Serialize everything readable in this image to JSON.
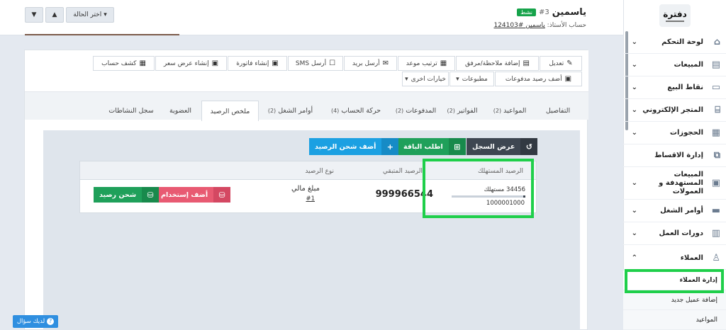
{
  "brand": {
    "logo_text": "دفترة"
  },
  "sidebar": {
    "items": [
      {
        "label": "لوحة التحكم",
        "icon": "home-icon"
      },
      {
        "label": "المبيعات",
        "icon": "invoice-icon"
      },
      {
        "label": "نقاط البيع",
        "icon": "monitor-icon"
      },
      {
        "label": "المتجر الإلكتروني",
        "icon": "store-icon"
      },
      {
        "label": "الحجوزات",
        "icon": "calendar-icon"
      },
      {
        "label": "إدارة الاقساط",
        "icon": "installments-icon"
      },
      {
        "label": "المبيعات المستهدفة و العمولات",
        "icon": "money-icon"
      },
      {
        "label": "أوامر الشغل",
        "icon": "briefcase-icon"
      },
      {
        "label": "دورات العمل",
        "icon": "cycle-icon"
      },
      {
        "label": "العملاء",
        "icon": "users-icon"
      }
    ],
    "sub_items": [
      "إدارة العملاء",
      "إضافة عميل جديد",
      "المواعيد"
    ]
  },
  "header": {
    "client_name": "ياسمين",
    "client_number": "#3",
    "status_badge": "نشط",
    "teacher_label": "حساب الأستاذ:",
    "teacher_link": "ياسمين #124103",
    "choose_status": "اختر الحالة"
  },
  "actions": {
    "row1": [
      "تعديل",
      "إضافة ملاحظة/مرفق",
      "ترتيب موعد",
      "أرسل بريد",
      "أرسل SMS",
      "إنشاء فاتورة",
      "إنشاء عرض سعر",
      "كشف حساب"
    ],
    "row2": [
      "أضف رصيد مدفوعات",
      "مطبوعات",
      "خيارات اخرى"
    ]
  },
  "tabs": [
    {
      "label": "التفاصيل",
      "count": ""
    },
    {
      "label": "المواعيد",
      "count": "(2)"
    },
    {
      "label": "الفواتير",
      "count": "(2)"
    },
    {
      "label": "المدفوعات",
      "count": "(2)"
    },
    {
      "label": "حركة الحساب",
      "count": "(4)"
    },
    {
      "label": "أوامر الشغل",
      "count": "(2)"
    },
    {
      "label": "ملخص الرصيد",
      "count": ""
    },
    {
      "label": "العضوية",
      "count": ""
    },
    {
      "label": "سجل النشاطات",
      "count": ""
    }
  ],
  "balance": {
    "view_log": "عرض السجل",
    "request_package": "اطلب الباقة",
    "add_charge": "أضف شحن الرصيد",
    "col_consumed": "الرصيد المستهلك",
    "col_remaining": "الرصيد المتبقي",
    "col_type": "نوع الرصيد",
    "consumed_text": "34456 مستهلك",
    "total": "1000001000",
    "remaining": "999966544",
    "type_name": "مبلغ مالي",
    "type_id": "#1",
    "add_usage": "أضف إستخدام",
    "charge": "شحن رصيد",
    "consumed_fraction": 0.034
  },
  "help": {
    "label": "لديك سؤال"
  },
  "colors": {
    "accent_blue": "#2f8fe0",
    "green": "#1fa05a",
    "dark": "#3e4651",
    "red": "#e85a72",
    "sky": "#1ba0e2",
    "highlight": "#1fcf4a"
  }
}
